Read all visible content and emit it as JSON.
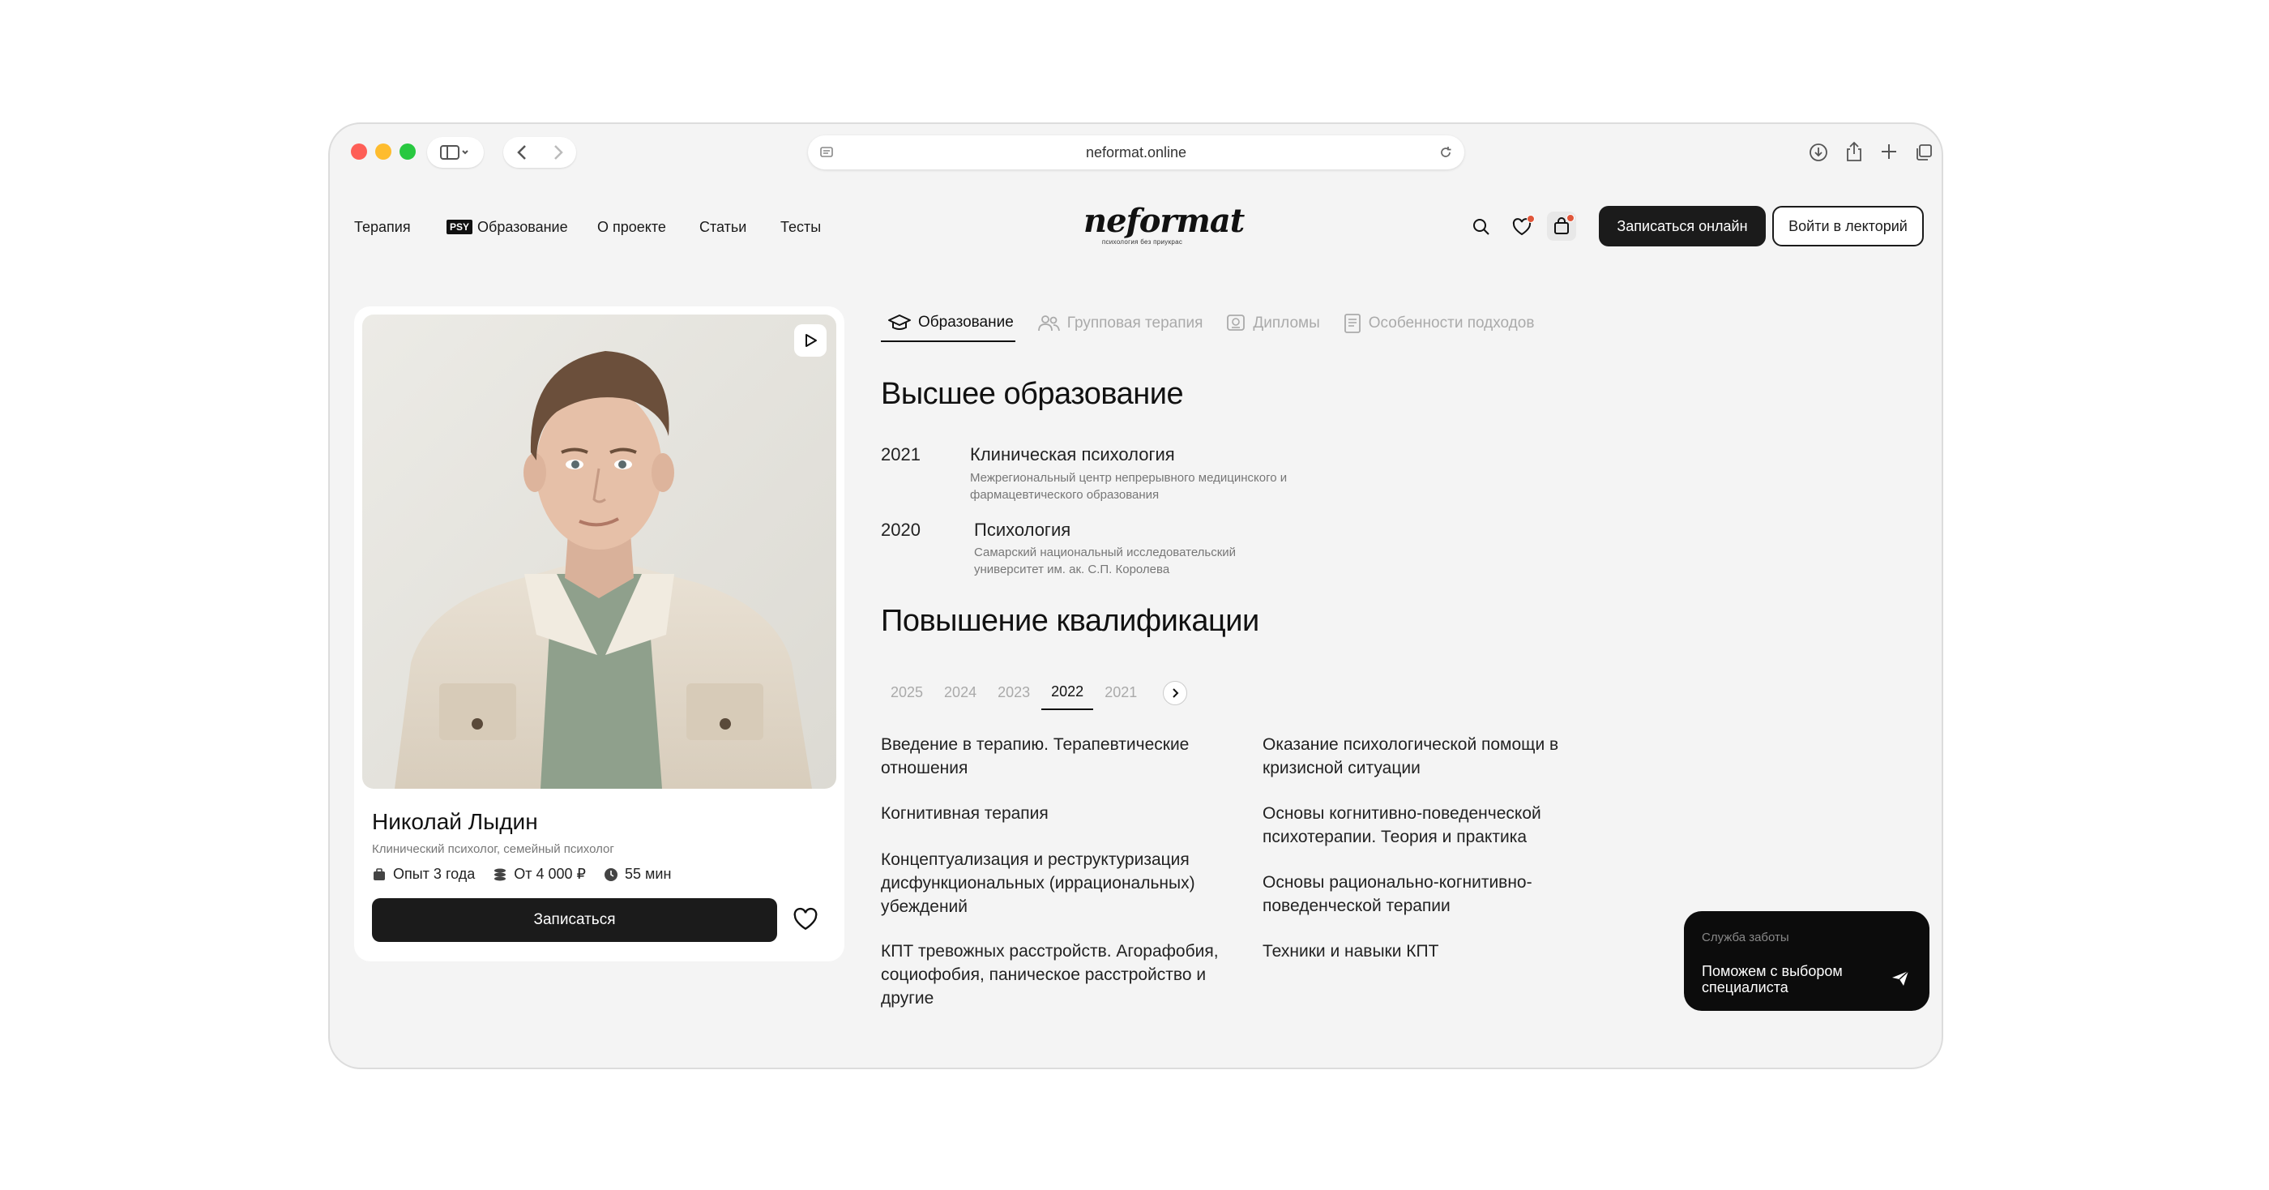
{
  "browser": {
    "url": "neformat.online"
  },
  "nav": {
    "links": [
      "Терапия",
      "Образование",
      "О проекте",
      "Статьи",
      "Тесты"
    ],
    "edu_badge": "PSY",
    "logo_main": "neformat",
    "logo_sub": "психология без приукрас",
    "btn_primary": "Записаться онлайн",
    "btn_secondary": "Войти в лекторий"
  },
  "profile": {
    "name": "Николай Лыдин",
    "role": "Клинический психолог, семейный психолог",
    "experience": "Опыт 3 года",
    "price": "От 4 000 ₽",
    "duration": "55 мин",
    "enroll_label": "Записаться"
  },
  "tabs": [
    {
      "label": "Образование",
      "icon": "graduation-cap-icon",
      "active": true
    },
    {
      "label": "Групповая терапия",
      "icon": "people-icon",
      "active": false
    },
    {
      "label": "Дипломы",
      "icon": "diploma-icon",
      "active": false
    },
    {
      "label": "Особенности подходов",
      "icon": "document-icon",
      "active": false
    }
  ],
  "higher_education": {
    "title": "Высшее образование",
    "items": [
      {
        "year": "2021",
        "title": "Клиническая психология",
        "org": "Межрегиональный центр непрерывного медицинского и фармацевтического образования"
      },
      {
        "year": "2020",
        "title": "Психология",
        "org": "Самарский национальный исследовательский университет им. ак. С.П. Королева"
      }
    ]
  },
  "qualification": {
    "title": "Повышение квалификации",
    "years": [
      "2025",
      "2024",
      "2023",
      "2022",
      "2021"
    ],
    "active_year": "2022",
    "courses_left": [
      "Введение в терапию. Терапевтические отношения",
      "Когнитивная терапия",
      "Концептуализация и реструктуризация дисфункциональных (иррациональных) убеждений",
      "КПТ тревожных расстройств. Агорафобия, социофобия, паническое расстройство и другие"
    ],
    "courses_right": [
      "Оказание психологической помощи в кризисной ситуации",
      "Основы когнитивно-поведенческой психотерапии. Теория и практика",
      "Основы рационально-когнитивно-поведенческой терапии",
      "Техники и навыки КПТ"
    ]
  },
  "care": {
    "label": "Служба заботы",
    "text": "Поможем с выбором специалиста"
  },
  "colors": {
    "dark": "#1b1b1b",
    "badge": "#e0563a",
    "window_bg": "#f4f4f4"
  }
}
